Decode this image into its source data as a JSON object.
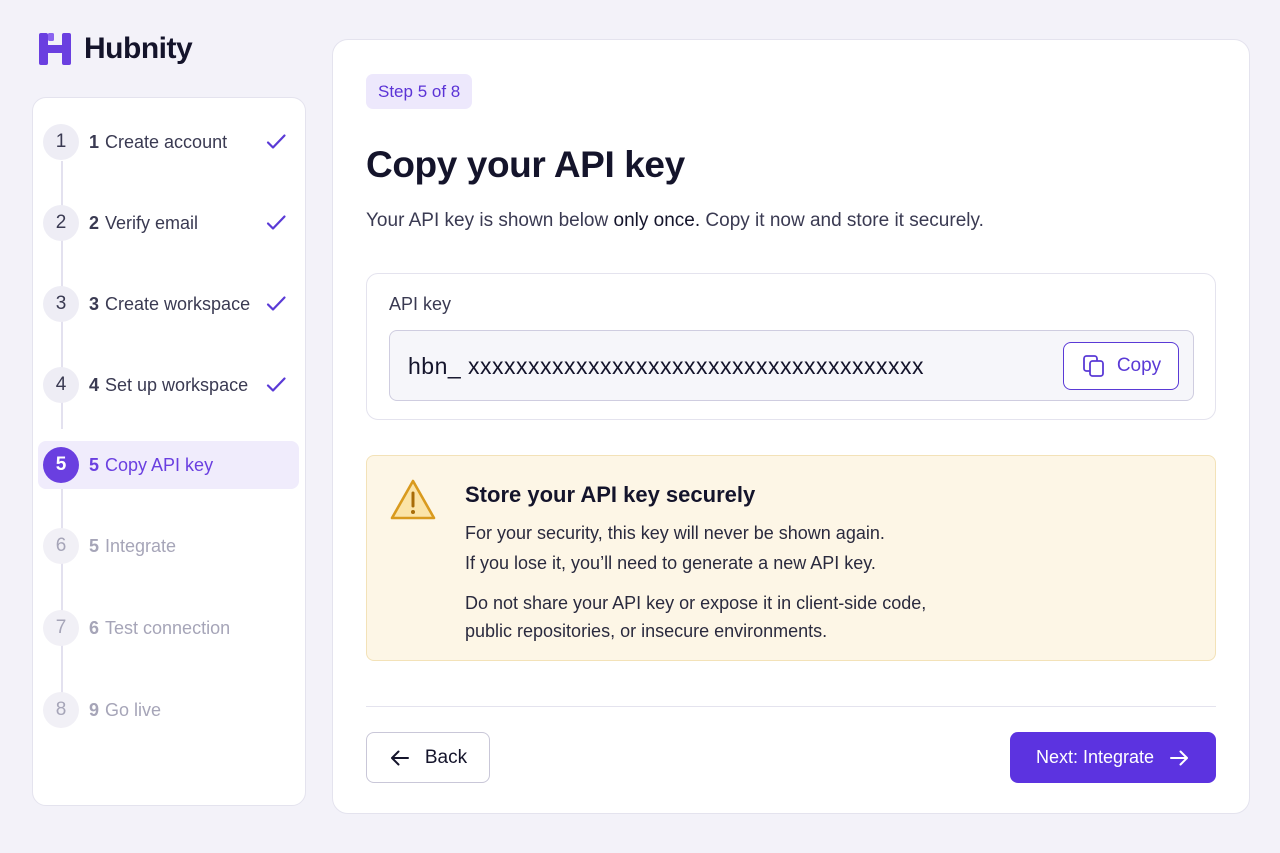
{
  "app": {
    "name": "Hubnity",
    "brand_color": "#6a3fe0"
  },
  "steps": [
    {
      "index": "1",
      "number": "1",
      "label": "Create account",
      "status": "complete"
    },
    {
      "index": "2",
      "number": "2",
      "label": "Verify email",
      "status": "complete"
    },
    {
      "index": "3",
      "number": "3",
      "label": "Create workspace",
      "status": "complete"
    },
    {
      "index": "4",
      "number": "4",
      "label": "Set up workspace",
      "status": "complete"
    },
    {
      "index": "5",
      "number": "5",
      "label": "Copy API key",
      "status": "active"
    },
    {
      "index": "6",
      "number": "5",
      "label": "Integrate",
      "status": "pending"
    },
    {
      "index": "7",
      "number": "6",
      "label": "Test connection",
      "status": "pending"
    },
    {
      "index": "8",
      "number": "9",
      "label": "Go live",
      "status": "pending"
    }
  ],
  "main": {
    "step_badge": "Step 5 of 8",
    "title": "Copy your API key",
    "subtitle_pre": "Your API key is shown below ",
    "subtitle_emphasis": "only once.",
    "subtitle_post": " Copy it now and store it securely.",
    "api_key_label": "API key",
    "api_key_value": "hbn_ xxxxxxxxxxxxxxxxxxxxxxxxxxxxxxxxxxxxxx",
    "copy_label": "Copy",
    "warning": {
      "title": "Store your API key securely",
      "line1": "For your security, this key will never be shown again.",
      "line2": "If you lose it, you’ll need to generate a new API key.",
      "line3": "Do not share your API key or expose it in client-side code,",
      "line4": "public repositories, or insecure environments."
    },
    "back_label": "Back",
    "next_label": "Next: Integrate"
  },
  "icons": {
    "logo": "hubnity-logo-icon",
    "check": "check-icon",
    "copy": "copy-icon",
    "warning": "warning-triangle-icon",
    "back": "arrow-left-icon",
    "next": "arrow-right-icon"
  }
}
